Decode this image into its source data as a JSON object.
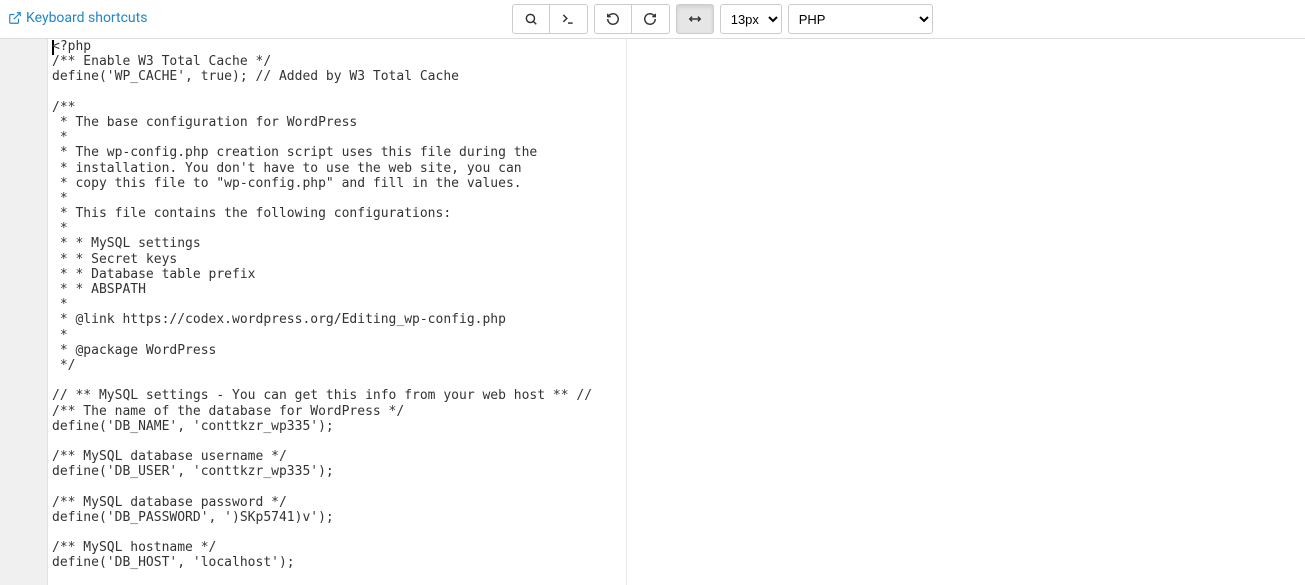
{
  "toolbar": {
    "keyboard_shortcuts_label": "Keyboard shortcuts",
    "font_size_selected": "13px",
    "syntax_selected": "PHP"
  },
  "editor": {
    "active_line_index": 0,
    "lines": [
      "<?php",
      "/** Enable W3 Total Cache */",
      "define('WP_CACHE', true); // Added by W3 Total Cache",
      "",
      "/**",
      " * The base configuration for WordPress",
      " *",
      " * The wp-config.php creation script uses this file during the",
      " * installation. You don't have to use the web site, you can",
      " * copy this file to \"wp-config.php\" and fill in the values.",
      " *",
      " * This file contains the following configurations:",
      " *",
      " * * MySQL settings",
      " * * Secret keys",
      " * * Database table prefix",
      " * * ABSPATH",
      " *",
      " * @link https://codex.wordpress.org/Editing_wp-config.php",
      " *",
      " * @package WordPress",
      " */",
      "",
      "// ** MySQL settings - You can get this info from your web host ** //",
      "/** The name of the database for WordPress */",
      "define('DB_NAME', 'conttkzr_wp335');",
      "",
      "/** MySQL database username */",
      "define('DB_USER', 'conttkzr_wp335');",
      "",
      "/** MySQL database password */",
      "define('DB_PASSWORD', ')SKp5741)v');",
      "",
      "/** MySQL hostname */",
      "define('DB_HOST', 'localhost');",
      ""
    ]
  }
}
